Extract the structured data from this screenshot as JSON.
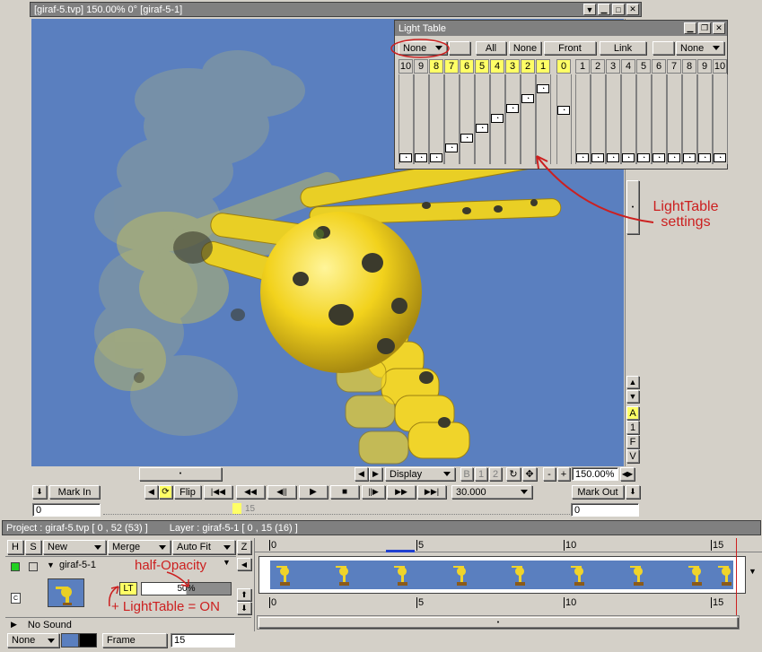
{
  "main_window": {
    "title": "[giraf-5.tvp]  150.00%   0°  [giraf-5-1]"
  },
  "light_table": {
    "title": "Light Table",
    "left_select": "None",
    "right_select": "None",
    "buttons": [
      "All",
      "None",
      "Front",
      "Link"
    ],
    "before_frames": [
      "10",
      "9",
      "8",
      "7",
      "6",
      "5",
      "4",
      "3",
      "2",
      "1"
    ],
    "current_frame": "0",
    "after_frames": [
      "1",
      "2",
      "3",
      "4",
      "5",
      "6",
      "7",
      "8",
      "9",
      "10"
    ],
    "active_color": "#ffff66"
  },
  "canvas_controls": {
    "display_select": "Display",
    "channel_buttons": [
      "B",
      "1",
      "2"
    ],
    "zoom": "150.00%",
    "zoom_minus": "-",
    "zoom_plus": "+"
  },
  "transport": {
    "mark_in": "Mark In",
    "flip": "Flip",
    "fps": "30.000",
    "mark_out": "Mark Out",
    "frame_start": "0",
    "frame_end": "0",
    "playhead_label": "15"
  },
  "side_letters": [
    "A",
    "1",
    "F",
    "V"
  ],
  "project_bar": {
    "project": "Project : giraf-5.tvp [ 0 , 52  (53) ]",
    "layer": "Layer : giraf-5-1 [ 0 , 15  (16) ]"
  },
  "layer_panel": {
    "col_h": "H",
    "col_s": "S",
    "new_select": "New",
    "merge_select": "Merge",
    "autofit_select": "Auto Fit",
    "col_z": "Z",
    "layer_name": "giraf-5-1",
    "lt_badge": "LT",
    "opacity": "50%",
    "no_sound": "No Sound",
    "bottom_select": "None",
    "frame_label": "Frame",
    "frame_value": "15"
  },
  "timeline": {
    "top_ticks": [
      "0",
      "5",
      "10",
      "15"
    ],
    "bottom_ticks": [
      "0",
      "5",
      "10",
      "15"
    ]
  },
  "annotations": {
    "lighttable_settings": "LightTable\nsettings",
    "half_opacity": "half-Opacity",
    "lighttable_on": "+ LightTable = ON"
  }
}
